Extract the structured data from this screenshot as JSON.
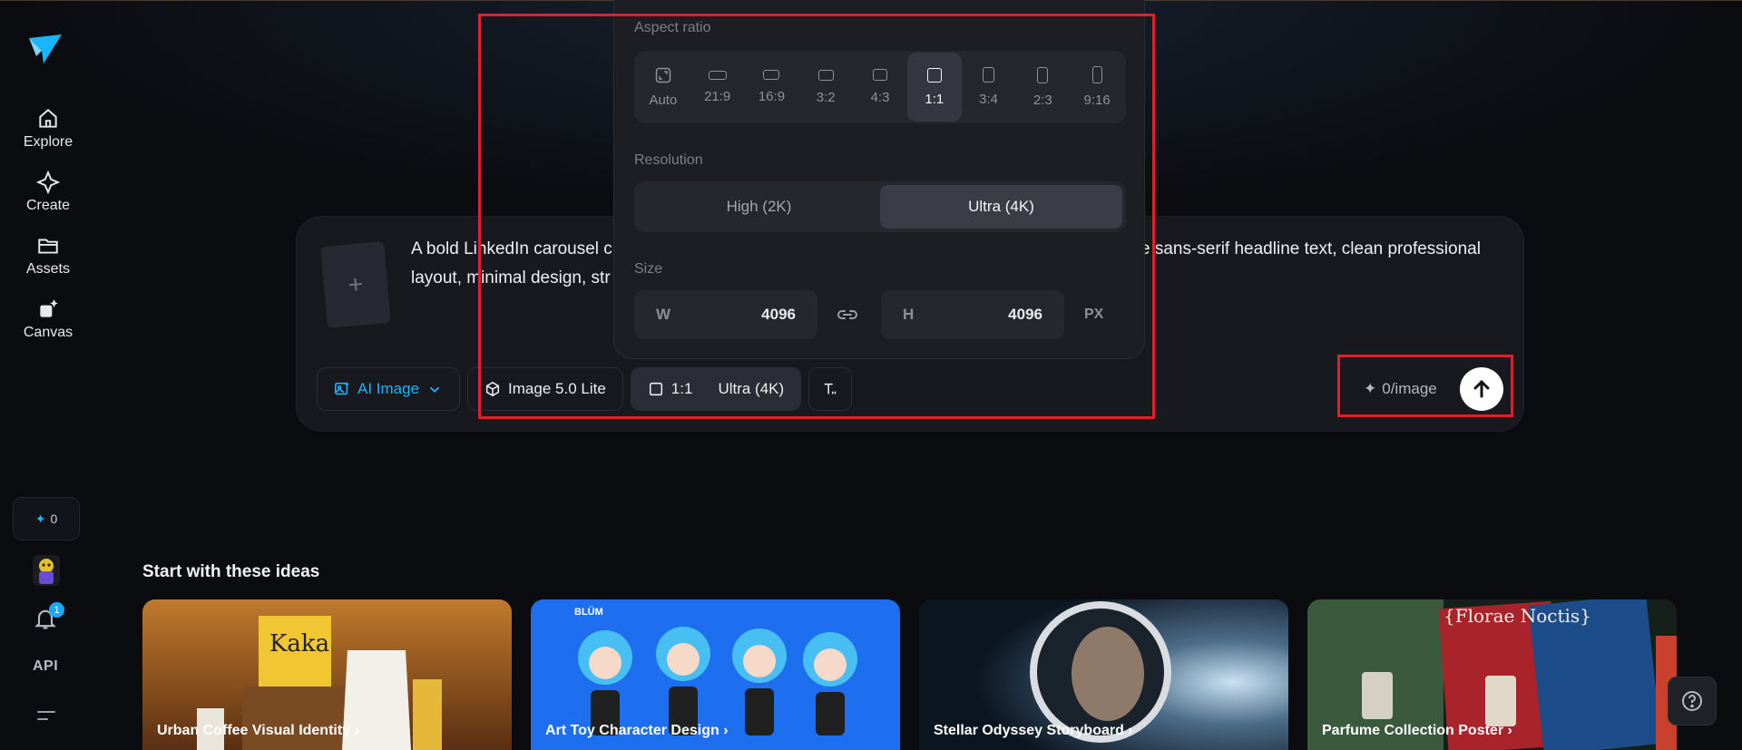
{
  "sidebar": {
    "nav": [
      {
        "label": "Explore",
        "icon": "home-icon"
      },
      {
        "label": "Create",
        "icon": "sparkle-icon"
      },
      {
        "label": "Assets",
        "icon": "folder-icon"
      },
      {
        "label": "Canvas",
        "icon": "canvas-icon"
      }
    ],
    "credits": "0",
    "notification_count": "1",
    "api_label": "API"
  },
  "prompt": {
    "text_left": "A bold LinkedIn carousel c",
    "text_right": "e sans-serif headline text, clean professional",
    "text_line2": "layout, minimal design, str",
    "upload_symbol": "+"
  },
  "toolbar": {
    "mode": "AI Image",
    "model": "Image 5.0 Lite",
    "ratio": "1:1",
    "resolution": "Ultra (4K)",
    "cost": "0/image"
  },
  "popover": {
    "aspect_label": "Aspect ratio",
    "ratios": [
      "Auto",
      "21:9",
      "16:9",
      "3:2",
      "4:3",
      "1:1",
      "3:4",
      "2:3",
      "9:16"
    ],
    "selected_ratio": "1:1",
    "resolution_label": "Resolution",
    "resolutions": [
      "High (2K)",
      "Ultra (4K)"
    ],
    "selected_resolution": "Ultra (4K)",
    "size_label": "Size",
    "width_key": "W",
    "width": "4096",
    "height_key": "H",
    "height": "4096",
    "unit": "PX"
  },
  "ideas": {
    "title": "Start with these ideas",
    "cards": [
      {
        "caption": "Urban Coffee Visual Identity  ›",
        "brand": "Kaka"
      },
      {
        "caption": "Art Toy Character Design  ›",
        "brand": "BLÜM"
      },
      {
        "caption": "Stellar Odyssey Storyboard  ›"
      },
      {
        "caption": "Parfume Collection Poster  ›",
        "brand": "{Florae Noctis}"
      }
    ]
  },
  "colors": {
    "accent": "#19b6ff",
    "annotation": "#e0202a",
    "background": "#0b0c10"
  }
}
